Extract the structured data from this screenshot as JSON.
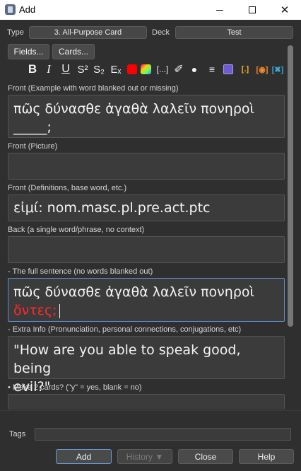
{
  "window": {
    "title": "Add"
  },
  "type_row": {
    "type_label": "Type",
    "type_value": "3. All-Purpose Card",
    "deck_label": "Deck",
    "deck_value": "Test"
  },
  "buttons": {
    "fields": "Fields...",
    "cards": "Cards..."
  },
  "toolbar": {
    "bold": "B",
    "italic": "I",
    "underline": "U",
    "superscript": "S²",
    "subscript": "S₂",
    "clear_format": "Eₓ",
    "cloze": "[...]",
    "attach": "✐",
    "record": "●",
    "more": "≡",
    "ext2": "[.]",
    "ext3": "[◉]",
    "ext4": "[✖]",
    "text_color": "#ff0000"
  },
  "fields": [
    {
      "label": "Front (Example with word blanked out or missing)",
      "line1": "πῶς δύνασθε ἀγαθὰ λαλεῖν πονηροὶ",
      "line2": "_____;"
    },
    {
      "label": "Front (Picture)",
      "value": ""
    },
    {
      "label": "Front (Definitions, base word, etc.)",
      "value": "εἰμί: nom.masc.pl.pre.act.ptc"
    },
    {
      "label": "Back (a single word/phrase, no context)",
      "value": ""
    },
    {
      "label": "- The full sentence (no words blanked out)",
      "line1": "πῶς δύνασθε ἀγαθὰ λαλεῖν πονηροὶ",
      "red_word": "ὄντες;"
    },
    {
      "label": "- Extra Info (Pronunciation, personal connections, conjugations, etc)",
      "line1": "\"How are you able to speak good, being",
      "line2": "evil?\""
    },
    {
      "label": "• Make 2 cards? (\"y\" = yes, blank = no)",
      "value": ""
    }
  ],
  "bottom": {
    "tags_label": "Tags",
    "add": "Add",
    "history": "History ▼",
    "close": "Close",
    "help": "Help"
  }
}
